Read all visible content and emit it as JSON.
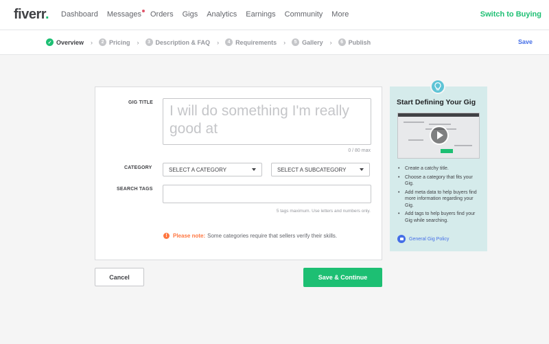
{
  "topnav": {
    "logo_text": "fiverr",
    "logo_dot": ".",
    "items": [
      {
        "label": "Dashboard",
        "has_dot": false
      },
      {
        "label": "Messages",
        "has_dot": true
      },
      {
        "label": "Orders",
        "has_dot": false
      },
      {
        "label": "Gigs",
        "has_dot": false
      },
      {
        "label": "Analytics",
        "has_dot": false
      },
      {
        "label": "Earnings",
        "has_dot": false
      },
      {
        "label": "Community",
        "has_dot": false
      },
      {
        "label": "More",
        "has_dot": false
      }
    ],
    "switch_label": "Switch to Buying"
  },
  "steps": {
    "items": [
      {
        "num": "✓",
        "label": "Overview",
        "active": true
      },
      {
        "num": "2",
        "label": "Pricing",
        "active": false
      },
      {
        "num": "3",
        "label": "Description & FAQ",
        "active": false
      },
      {
        "num": "4",
        "label": "Requirements",
        "active": false
      },
      {
        "num": "5",
        "label": "Gallery",
        "active": false
      },
      {
        "num": "6",
        "label": "Publish",
        "active": false
      }
    ],
    "separator": "›",
    "save_label": "Save"
  },
  "form": {
    "gig_title_label": "GIG TITLE",
    "gig_title_placeholder": "I will do something I'm really good at",
    "gig_title_value": "",
    "counter": "0 / 80 max",
    "category_label": "CATEGORY",
    "category_value": "SELECT A CATEGORY",
    "subcategory_value": "SELECT A SUBCATEGORY",
    "tags_label": "SEARCH TAGS",
    "tags_value": "",
    "tags_hint": "5 tags maximum. Use letters and numbers only.",
    "note_prefix": "Please note:",
    "note_text": "Some categories require that sellers verify their skills."
  },
  "actions": {
    "cancel_label": "Cancel",
    "continue_label": "Save & Continue"
  },
  "side": {
    "title": "Start Defining Your Gig",
    "tips": [
      "Create a catchy title.",
      "Choose a category that fits your Gig.",
      "Add meta data to help buyers find more information regarding your Gig.",
      "Add tags to help buyers find your Gig while searching."
    ],
    "policy_label": "General Gig Policy"
  },
  "colors": {
    "brand_green": "#1dbf73",
    "link_blue": "#446ee7",
    "note_orange": "#ff7640",
    "side_bg": "#d5ebeb"
  }
}
